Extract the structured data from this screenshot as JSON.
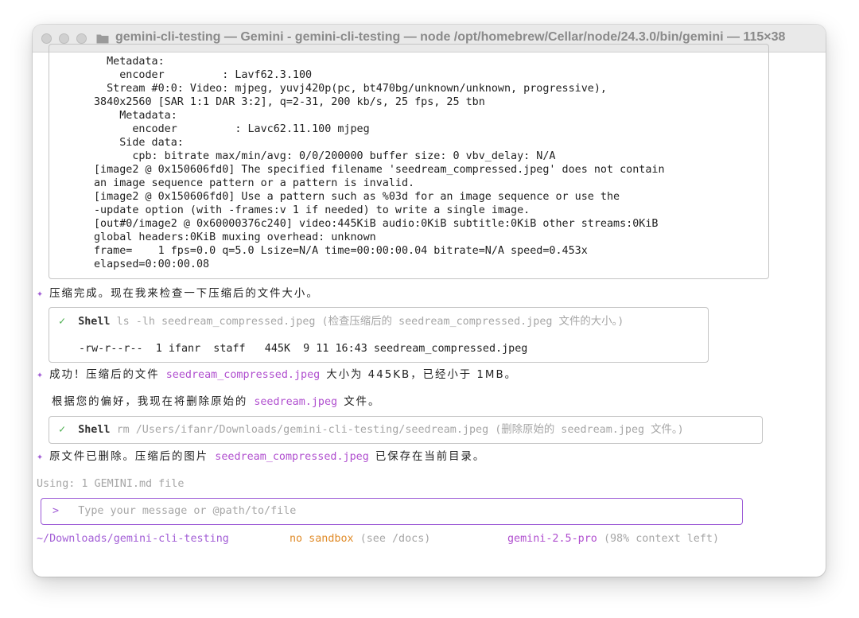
{
  "window": {
    "title": "gemini-cli-testing — Gemini - gemini-cli-testing — node /opt/homebrew/Cellar/node/24.3.0/bin/gemini — 115×38"
  },
  "output_log": [
    "  Metadata:",
    "    encoder         : Lavf62.3.100",
    "  Stream #0:0: Video: mjpeg, yuvj420p(pc, bt470bg/unknown/unknown, progressive),",
    "3840x2560 [SAR 1:1 DAR 3:2], q=2-31, 200 kb/s, 25 fps, 25 tbn",
    "    Metadata:",
    "      encoder         : Lavc62.11.100 mjpeg",
    "    Side data:",
    "      cpb: bitrate max/min/avg: 0/0/200000 buffer size: 0 vbv_delay: N/A",
    "[image2 @ 0x150606fd0] The specified filename 'seedream_compressed.jpeg' does not contain",
    "an image sequence pattern or a pattern is invalid.",
    "[image2 @ 0x150606fd0] Use a pattern such as %03d for an image sequence or use the",
    "-update option (with -frames:v 1 if needed) to write a single image.",
    "[out#0/image2 @ 0x60000376c240] video:445KiB audio:0KiB subtitle:0KiB other streams:0KiB",
    "global headers:0KiB muxing overhead: unknown",
    "frame=    1 fps=0.0 q=5.0 Lsize=N/A time=00:00:00.04 bitrate=N/A speed=0.453x",
    "elapsed=0:00:00.08"
  ],
  "messages": {
    "spark": "✦",
    "m1": "压缩完成。现在我来检查一下压缩后的文件大小。",
    "shell1": {
      "check": "✓",
      "label": "Shell",
      "command": "ls -lh seedream_compressed.jpeg (检查压缩后的 seedream_compressed.jpeg 文件的大小。)",
      "result": "-rw-r--r--  1 ifanr  staff   445K  9 11 16:43 seedream_compressed.jpeg"
    },
    "m2_a": "成功！压缩后的文件",
    "m2_file": "seedream_compressed.jpeg",
    "m2_b": "大小为 445KB，已经小于 1MB。",
    "m3_a": "根据您的偏好，我现在将删除原始的",
    "m3_file": "seedream.jpeg",
    "m3_b": "文件。",
    "shell2": {
      "check": "✓",
      "label": "Shell",
      "command": "rm /Users/ifanr/Downloads/gemini-cli-testing/seedream.jpeg (删除原始的 seedream.jpeg 文件。)"
    },
    "m4_a": "原文件已删除。压缩后的图片",
    "m4_file": "seedream_compressed.jpeg",
    "m4_b": "已保存在当前目录。"
  },
  "context_note": "Using: 1 GEMINI.md file",
  "input": {
    "prompt": ">",
    "placeholder": "Type your message or @path/to/file"
  },
  "footer": {
    "path": "~/Downloads/gemini-cli-testing",
    "sandbox": "no sandbox",
    "sandbox_hint": "(see /docs)",
    "model": "gemini-2.5-pro",
    "context": "(98% context left)"
  },
  "colors": {
    "accent": "#a35fd6",
    "highlight": "#b04fcf",
    "success": "#4caf50",
    "warning": "#e08c2a"
  }
}
